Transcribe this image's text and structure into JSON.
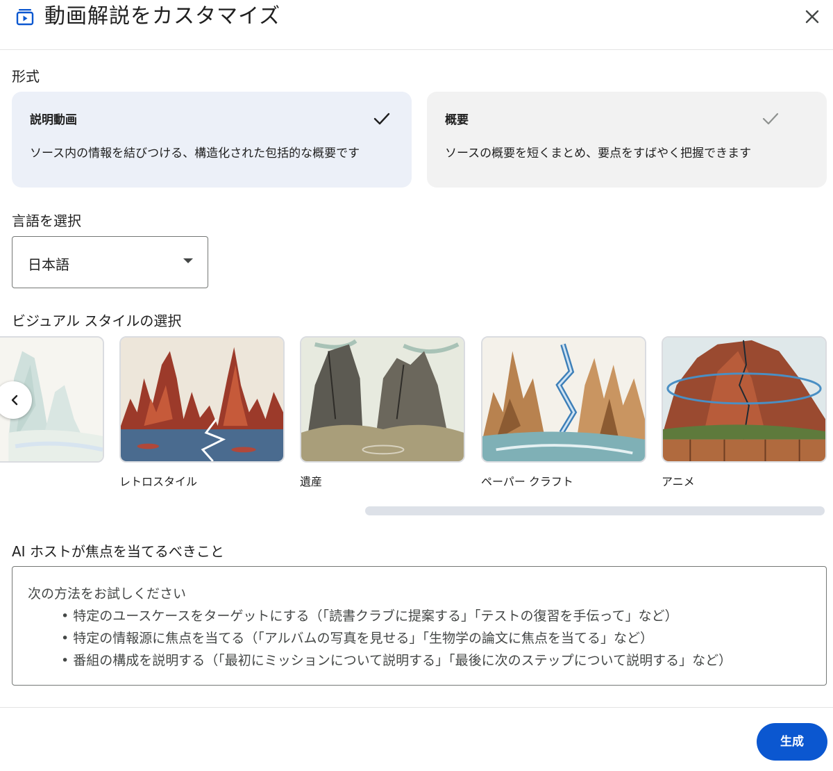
{
  "header": {
    "title": "動画解説をカスタマイズ",
    "icon": "video-icon",
    "close_icon": "close-icon"
  },
  "format": {
    "label": "形式",
    "options": [
      {
        "title": "説明動画",
        "description": "ソース内の情報を結びつける、構造化された包括的な概要です",
        "selected": true
      },
      {
        "title": "概要",
        "description": "ソースの概要を短くまとめ、要点をすばやく把握できます",
        "selected": false
      }
    ]
  },
  "language": {
    "label": "言語を選択",
    "value": "日本語"
  },
  "visual_style": {
    "label": "ビジュアル スタイルの選択",
    "styles": [
      {
        "label": ""
      },
      {
        "label": "レトロスタイル"
      },
      {
        "label": "遺産"
      },
      {
        "label": "ペーパー クラフト"
      },
      {
        "label": "アニメ"
      }
    ]
  },
  "focus": {
    "label": "AI ホストが焦点を当てるべきこと",
    "hint_title": "次の方法をお試しください",
    "hints": [
      "• 特定のユースケースをターゲットにする（「読書クラブに提案する」「テストの復習を手伝って」など）",
      "• 特定の情報源に焦点を当てる（「アルバムの写真を見せる」「生物学の論文に焦点を当てる」など）",
      "• 番組の構成を説明する（「最初にミッションについて説明する」「最後に次のステップについて説明する」など）"
    ]
  },
  "actions": {
    "generate_label": "生成"
  },
  "colors": {
    "primary": "#0b57d0",
    "selected_card": "#ecf0f8",
    "card": "#f2f2f2"
  }
}
